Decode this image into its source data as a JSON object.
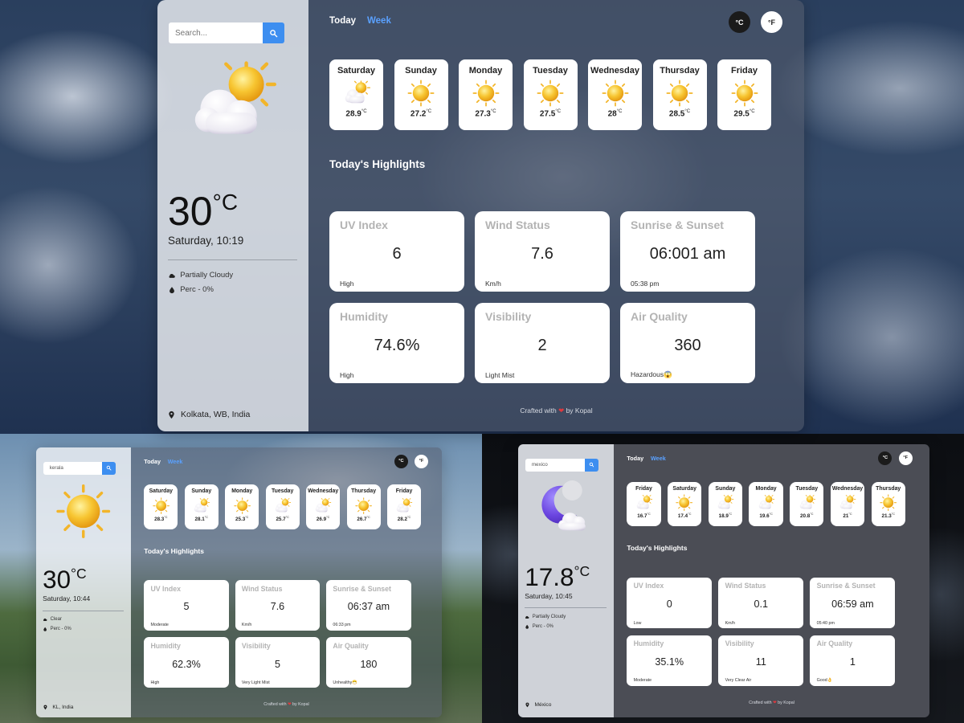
{
  "panels": [
    {
      "search": {
        "placeholder": "Search...",
        "value": ""
      },
      "weather_icon": "sun-behind-cloud-icon",
      "temperature": "30",
      "unit_symbol": "°C",
      "datetime": "Saturday, 10:19",
      "condition": "Partially Cloudy",
      "precip": "Perc - 0%",
      "location": "Kolkata, WB, India",
      "tabs": {
        "today": "Today",
        "week": "Week"
      },
      "unit_buttons": {
        "celsius": "°C",
        "fahrenheit": "°F"
      },
      "forecast": [
        {
          "day": "Saturday",
          "icon": "sun-behind-cloud-icon",
          "temp": "28.9",
          "unit": "°C"
        },
        {
          "day": "Sunday",
          "icon": "sun-icon",
          "temp": "27.2",
          "unit": "°C"
        },
        {
          "day": "Monday",
          "icon": "sun-icon",
          "temp": "27.3",
          "unit": "°C"
        },
        {
          "day": "Tuesday",
          "icon": "sun-icon",
          "temp": "27.5",
          "unit": "°C"
        },
        {
          "day": "Wednesday",
          "icon": "sun-icon",
          "temp": "28",
          "unit": "°C"
        },
        {
          "day": "Thursday",
          "icon": "sun-icon",
          "temp": "28.5",
          "unit": "°C"
        },
        {
          "day": "Friday",
          "icon": "sun-icon",
          "temp": "29.5",
          "unit": "°C"
        }
      ],
      "highlights_title": "Today's Highlights",
      "highlights": [
        {
          "title": "UV Index",
          "value": "6",
          "sub": "High"
        },
        {
          "title": "Wind Status",
          "value": "7.6",
          "sub": "Km/h"
        },
        {
          "title": "Sunrise & Sunset",
          "value": "06:001 am",
          "sub": "05:38 pm"
        },
        {
          "title": "Humidity",
          "value": "74.6%",
          "sub": "High"
        },
        {
          "title": "Visibility",
          "value": "2",
          "sub": "Light Mist"
        },
        {
          "title": "Air Quality",
          "value": "360",
          "sub": "Hazardous😱"
        }
      ],
      "footer": {
        "prefix": "Crafted with",
        "heart": "❤",
        "suffix": "by Kopal"
      }
    },
    {
      "search": {
        "placeholder": "Search...",
        "value": "kerala"
      },
      "weather_icon": "sun-icon",
      "temperature": "30",
      "unit_symbol": "°C",
      "datetime": "Saturday, 10:44",
      "condition": "Clear",
      "precip": "Perc - 0%",
      "location": "KL, India",
      "tabs": {
        "today": "Today",
        "week": "Week"
      },
      "unit_buttons": {
        "celsius": "°C",
        "fahrenheit": "°F"
      },
      "forecast": [
        {
          "day": "Saturday",
          "icon": "sun-icon",
          "temp": "28.3",
          "unit": "°C"
        },
        {
          "day": "Sunday",
          "icon": "sun-behind-cloud-icon",
          "temp": "28.1",
          "unit": "°C"
        },
        {
          "day": "Monday",
          "icon": "sun-icon",
          "temp": "25.3",
          "unit": "°C"
        },
        {
          "day": "Tuesday",
          "icon": "sun-behind-cloud-icon",
          "temp": "25.7",
          "unit": "°C"
        },
        {
          "day": "Wednesday",
          "icon": "sun-behind-cloud-icon",
          "temp": "26.9",
          "unit": "°C"
        },
        {
          "day": "Thursday",
          "icon": "sun-icon",
          "temp": "26.7",
          "unit": "°C"
        },
        {
          "day": "Friday",
          "icon": "sun-behind-cloud-icon",
          "temp": "28.2",
          "unit": "°C"
        }
      ],
      "highlights_title": "Today's Highlights",
      "highlights": [
        {
          "title": "UV Index",
          "value": "5",
          "sub": "Moderate"
        },
        {
          "title": "Wind Status",
          "value": "7.6",
          "sub": "Km/h"
        },
        {
          "title": "Sunrise & Sunset",
          "value": "06:37 am",
          "sub": "06:33 pm"
        },
        {
          "title": "Humidity",
          "value": "62.3%",
          "sub": "High"
        },
        {
          "title": "Visibility",
          "value": "5",
          "sub": "Very Light Mist"
        },
        {
          "title": "Air Quality",
          "value": "180",
          "sub": "Unhealthy😷"
        }
      ],
      "footer": {
        "prefix": "Crafted with",
        "heart": "❤",
        "suffix": "by Kopal"
      }
    },
    {
      "search": {
        "placeholder": "Search...",
        "value": "mexico"
      },
      "weather_icon": "moon-behind-cloud-icon",
      "temperature": "17.8",
      "unit_symbol": "°C",
      "datetime": "Saturday, 10:45",
      "condition": "Partially Cloudy",
      "precip": "Perc - 0%",
      "location": "México",
      "tabs": {
        "today": "Today",
        "week": "Week"
      },
      "unit_buttons": {
        "celsius": "°C",
        "fahrenheit": "°F"
      },
      "forecast": [
        {
          "day": "Friday",
          "icon": "sun-behind-cloud-icon",
          "temp": "16.7",
          "unit": "°C"
        },
        {
          "day": "Saturday",
          "icon": "sun-icon",
          "temp": "17.4",
          "unit": "°C"
        },
        {
          "day": "Sunday",
          "icon": "sun-behind-cloud-icon",
          "temp": "18.9",
          "unit": "°C"
        },
        {
          "day": "Monday",
          "icon": "sun-behind-cloud-icon",
          "temp": "19.6",
          "unit": "°C"
        },
        {
          "day": "Tuesday",
          "icon": "sun-behind-cloud-icon",
          "temp": "20.8",
          "unit": "°C"
        },
        {
          "day": "Wednesday",
          "icon": "sun-behind-cloud-icon",
          "temp": "21",
          "unit": "°C"
        },
        {
          "day": "Thursday",
          "icon": "sun-icon",
          "temp": "21.3",
          "unit": "°C"
        }
      ],
      "highlights_title": "Today's Highlights",
      "highlights": [
        {
          "title": "UV Index",
          "value": "0",
          "sub": "Low"
        },
        {
          "title": "Wind Status",
          "value": "0.1",
          "sub": "Km/h"
        },
        {
          "title": "Sunrise & Sunset",
          "value": "06:59 am",
          "sub": "05:40 pm"
        },
        {
          "title": "Humidity",
          "value": "35.1%",
          "sub": "Moderate"
        },
        {
          "title": "Visibility",
          "value": "11",
          "sub": "Very Clear Air"
        },
        {
          "title": "Air Quality",
          "value": "1",
          "sub": "Good👌"
        }
      ],
      "footer": {
        "prefix": "Crafted with",
        "heart": "❤",
        "suffix": "by Kopal"
      }
    }
  ],
  "colors": {
    "accent": "#3d8ef0",
    "week_tab": "#5aa1ff",
    "heart": "#e0393e",
    "card_title": "#b3b3b3"
  }
}
